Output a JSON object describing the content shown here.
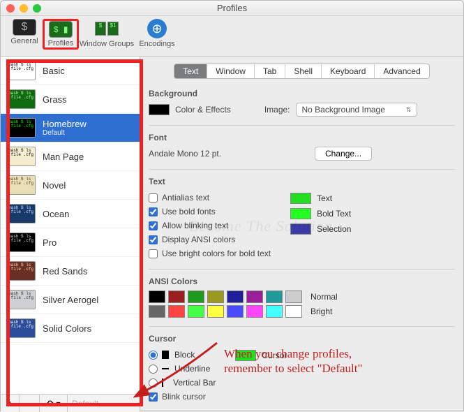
{
  "window": {
    "title": "Profiles"
  },
  "toolbar": {
    "general": "General",
    "profiles": "Profiles",
    "window_groups": "Window Groups",
    "encodings": "Encodings"
  },
  "sidebar": {
    "profiles": [
      {
        "name": "Basic",
        "thumb_bg": "#ffffff",
        "thumb_fg": "#000"
      },
      {
        "name": "Grass",
        "thumb_bg": "#0f6b0f",
        "thumb_fg": "#b7ffb7"
      },
      {
        "name": "Homebrew",
        "sub": "Default",
        "thumb_bg": "#000",
        "thumb_fg": "#0f0",
        "selected": true
      },
      {
        "name": "Man Page",
        "thumb_bg": "#f5edcf",
        "thumb_fg": "#000"
      },
      {
        "name": "Novel",
        "thumb_bg": "#e8dfb6",
        "thumb_fg": "#5b3a14"
      },
      {
        "name": "Ocean",
        "thumb_bg": "#183a6b",
        "thumb_fg": "#cfe2ff"
      },
      {
        "name": "Pro",
        "thumb_bg": "#000",
        "thumb_fg": "#ddd"
      },
      {
        "name": "Red Sands",
        "thumb_bg": "#6a2f24",
        "thumb_fg": "#ffd9b3"
      },
      {
        "name": "Silver Aerogel",
        "thumb_bg": "#cfd0d1",
        "thumb_fg": "#333"
      },
      {
        "name": "Solid Colors",
        "thumb_bg": "#2b4d9a",
        "thumb_fg": "#fff"
      }
    ],
    "buttons": {
      "add": "+",
      "remove": "−",
      "gear": "⚙︎ ▾",
      "default": "Default"
    }
  },
  "tabs": [
    "Text",
    "Window",
    "Tab",
    "Shell",
    "Keyboard",
    "Advanced"
  ],
  "active_tab": "Text",
  "panel": {
    "bg_header": "Background",
    "color_effects": "Color & Effects",
    "bg_swatch": "#000000",
    "image_label": "Image:",
    "image_value": "No Background Image",
    "font_header": "Font",
    "font_value": "Andale Mono 12 pt.",
    "change_btn": "Change...",
    "text_header": "Text",
    "antialias": "Antialias text",
    "bold_fonts": "Use bold fonts",
    "blink_text": "Allow blinking text",
    "display_ansi": "Display ANSI colors",
    "bright_bold": "Use bright colors for bold text",
    "text_label": "Text",
    "text_color": "#22dd22",
    "bold_label": "Bold Text",
    "bold_color": "#22ff22",
    "sel_label": "Selection",
    "sel_color": "#3c3ca8",
    "ansi_header": "ANSI Colors",
    "normal_label": "Normal",
    "bright_label": "Bright",
    "ansi_normal": [
      "#000000",
      "#9a1f1f",
      "#1f9a1f",
      "#9a9a1f",
      "#1f1f9a",
      "#9a1f9a",
      "#1f9a9a",
      "#cccccc"
    ],
    "ansi_bright": [
      "#666666",
      "#ff4444",
      "#44ff44",
      "#ffff44",
      "#4a4aff",
      "#ff44ff",
      "#44ffff",
      "#ffffff"
    ],
    "cursor_header": "Cursor",
    "block": "Block",
    "underline": "Underline",
    "vbar": "Vertical Bar",
    "blink_cursor": "Blink cursor",
    "cursor_label": "Cursor",
    "cursor_color": "#22dd22"
  },
  "annotation": {
    "line1": "When you change profiles,",
    "line2": "remember to select \"Default\""
  },
  "watermark": "Become The Solution"
}
